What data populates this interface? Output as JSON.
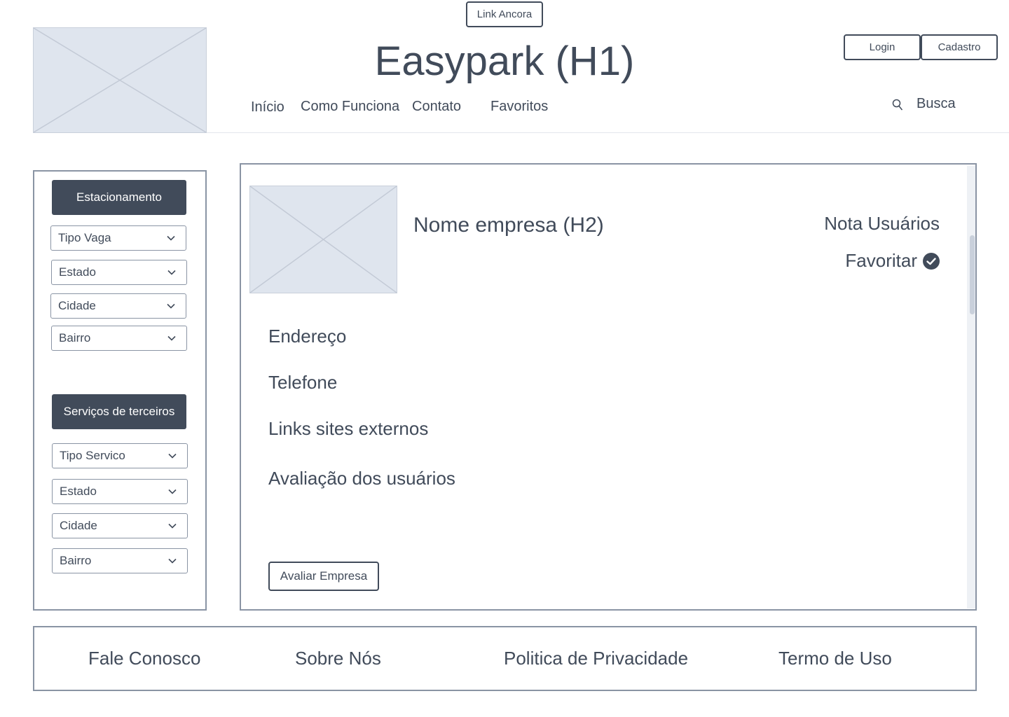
{
  "header": {
    "anchor_link": "Link Ancora",
    "title": "Easypark (H1)",
    "login_label": "Login",
    "signup_label": "Cadastro",
    "nav": [
      {
        "label": "Início"
      },
      {
        "label": "Como Funciona"
      },
      {
        "label": "Contato"
      },
      {
        "label": "Favoritos"
      }
    ],
    "search_label": "Busca"
  },
  "sidebar": {
    "parking": {
      "heading": "Estacionamento",
      "filters": [
        "Tipo Vaga",
        "Estado",
        "Cidade",
        "Bairro"
      ]
    },
    "services": {
      "heading": "Serviços de terceiros",
      "filters": [
        "Tipo Servico",
        "Estado",
        "Cidade",
        "Bairro"
      ]
    }
  },
  "company": {
    "name": "Nome empresa (H2)",
    "user_rating": "Nota Usuários",
    "favorite_label": "Favoritar",
    "address": "Endereço",
    "phone": "Telefone",
    "external_links": "Links sites externos",
    "user_reviews": "Avaliação dos usuários",
    "rate_button": "Avaliar Empresa"
  },
  "footer": {
    "links": [
      "Fale Conosco",
      "Sobre Nós",
      "Politica de Privacidade",
      "Termo de Uso"
    ]
  },
  "colors": {
    "primary": "#414b5a",
    "border": "#8a94a4",
    "placeholder": "#dfe5ee"
  },
  "icons": {
    "search": "search-icon",
    "favorite": "check-circle-icon",
    "dropdown": "chevron-down-icon"
  }
}
